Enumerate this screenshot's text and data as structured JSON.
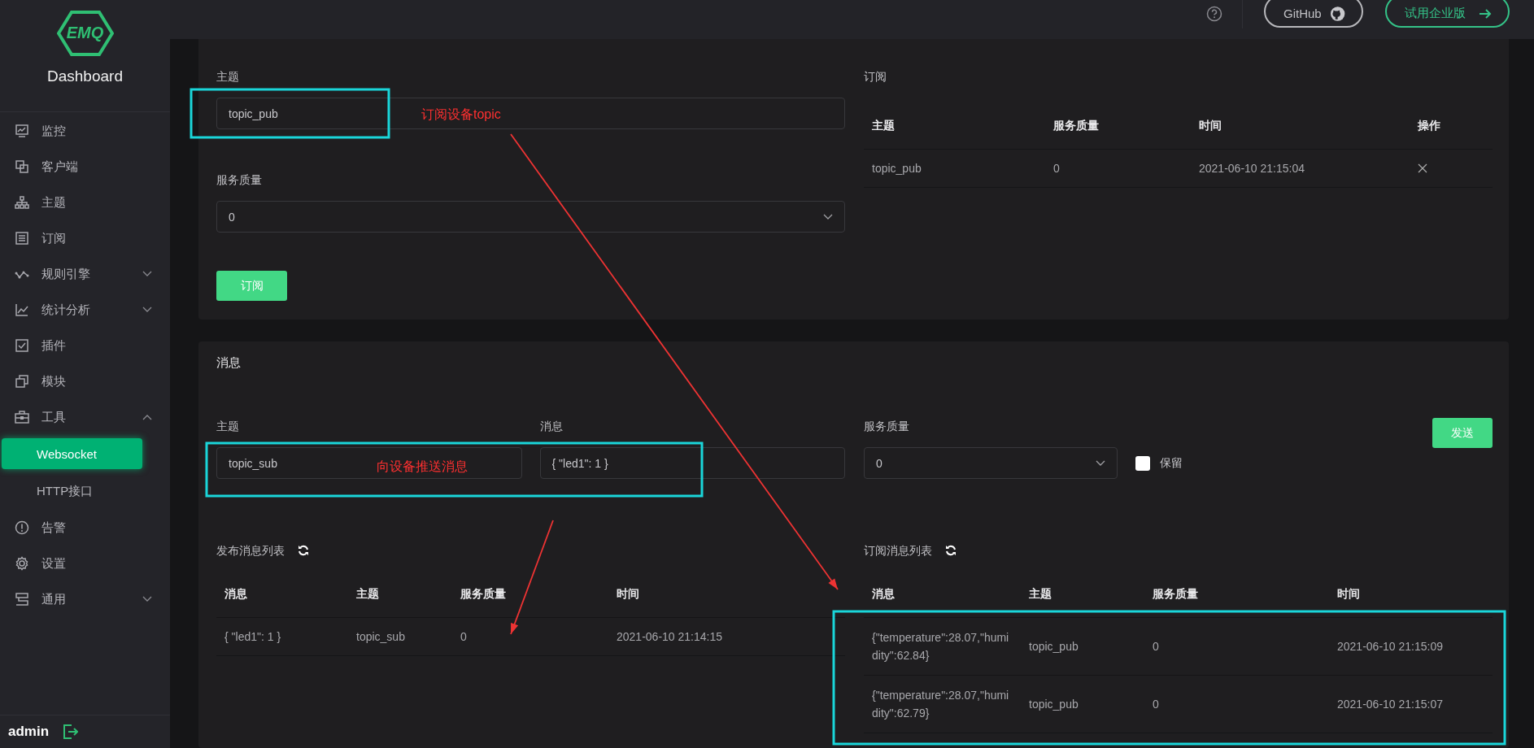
{
  "sidebar": {
    "logo": "EMQ",
    "title": "Dashboard",
    "items": [
      {
        "label": "监控",
        "kind": "link",
        "selected": false
      },
      {
        "label": "客户端",
        "kind": "link",
        "selected": false
      },
      {
        "label": "主题",
        "kind": "link",
        "selected": false
      },
      {
        "label": "订阅",
        "kind": "link",
        "selected": false
      },
      {
        "label": "规则引擎",
        "kind": "group",
        "expanded": false,
        "selected": false
      },
      {
        "label": "统计分析",
        "kind": "group",
        "expanded": false,
        "selected": false
      },
      {
        "label": "插件",
        "kind": "link",
        "selected": false
      },
      {
        "label": "模块",
        "kind": "link",
        "selected": false
      },
      {
        "label": "工具",
        "kind": "group",
        "expanded": true,
        "selected": false,
        "children": [
          {
            "label": "Websocket",
            "selected": true
          },
          {
            "label": "HTTP接口",
            "selected": false
          }
        ]
      },
      {
        "label": "告警",
        "kind": "link",
        "selected": false
      },
      {
        "label": "设置",
        "kind": "link",
        "selected": false
      },
      {
        "label": "通用",
        "kind": "group",
        "expanded": false,
        "selected": false
      }
    ],
    "user": "admin"
  },
  "topbar": {
    "github": "GitHub",
    "trial": "试用企业版"
  },
  "subscribe": {
    "topic_label": "主题",
    "topic_value": "topic_pub",
    "qos_label": "服务质量",
    "qos_value": "0",
    "button": "订阅",
    "list_title": "订阅",
    "columns": [
      "主题",
      "服务质量",
      "时间",
      "操作"
    ],
    "rows": [
      {
        "topic": "topic_pub",
        "qos": "0",
        "time": "2021-06-10 21:15:04"
      }
    ]
  },
  "message": {
    "title": "消息",
    "topic_label": "主题",
    "topic_value": "topic_sub",
    "payload_label": "消息",
    "payload_value": "{ \"led1\": 1 }",
    "qos_label": "服务质量",
    "qos_value": "0",
    "retain": {
      "label": "保留",
      "checked": false
    },
    "button": "发送",
    "published": {
      "title": "发布消息列表",
      "columns": [
        "消息",
        "主题",
        "服务质量",
        "时间"
      ],
      "rows": [
        {
          "message": "{ \"led1\": 1 }",
          "topic": "topic_sub",
          "qos": "0",
          "time": "2021-06-10 21:14:15"
        }
      ]
    },
    "received": {
      "title": "订阅消息列表",
      "columns": [
        "消息",
        "主题",
        "服务质量",
        "时间"
      ],
      "rows": [
        {
          "message": "{\"temperature\":28.07,\"humidity\":62.84}",
          "topic": "topic_pub",
          "qos": "0",
          "time": "2021-06-10 21:15:09"
        },
        {
          "message": "{\"temperature\":28.07,\"humidity\":62.79}",
          "topic": "topic_pub",
          "qos": "0",
          "time": "2021-06-10 21:15:07"
        }
      ]
    }
  },
  "annotations": [
    {
      "kind": "box"
    },
    {
      "kind": "note",
      "text": "订阅设备topic"
    },
    {
      "kind": "arrow"
    },
    {
      "kind": "box"
    },
    {
      "kind": "note",
      "text": "向设备推送消息"
    },
    {
      "kind": "arrow"
    },
    {
      "kind": "box"
    }
  ]
}
